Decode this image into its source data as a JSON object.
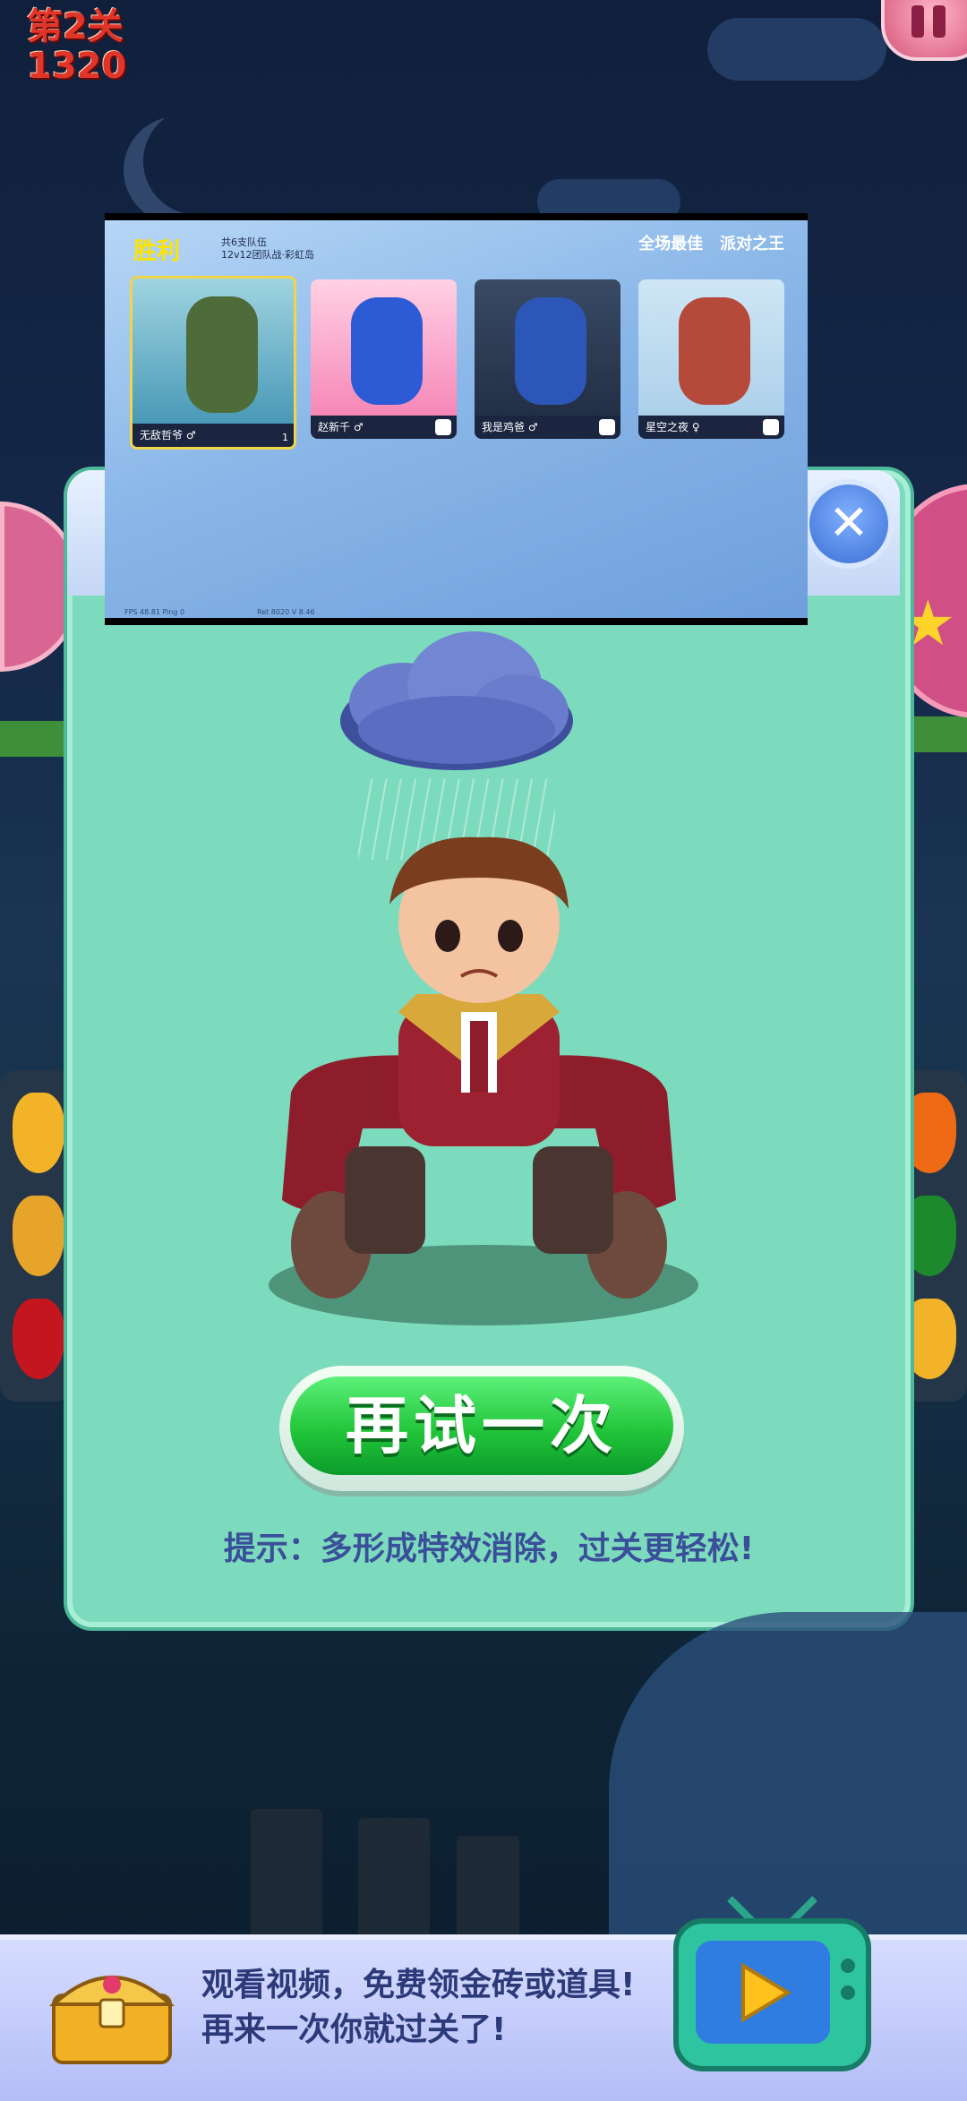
{
  "hud": {
    "level": "第2关",
    "score": "1320"
  },
  "embed": {
    "victory": "胜利",
    "teams_line1": "共6支队伍",
    "teams_line2": "12v12团队战·彩虹岛",
    "award1": "全场最佳",
    "award2": "派对之王",
    "players": [
      {
        "name": "无敌哲爷 ♂",
        "likes": "1"
      },
      {
        "name": "赵新千 ♂",
        "likes": ""
      },
      {
        "name": "我是鸡爸 ♂",
        "likes": ""
      },
      {
        "name": "星空之夜 ♀",
        "likes": ""
      }
    ],
    "footer1": "FPS 48.81  Ping 0",
    "footer2": "Ret 8020  V 8.46"
  },
  "dialog": {
    "retry_label": "再试一次",
    "hint": "提示：多形成特效消除，过关更轻松!",
    "close_icon": "close-icon"
  },
  "banner": {
    "line1": "观看视频，免费领金砖或道具!",
    "line2": "再来一次你就过关了!"
  },
  "colors": {
    "dialog_bg": "#7ddbbd",
    "retry_green": "#22c63a",
    "hint_text": "#3a4f9a",
    "level_red": "#e2352a"
  }
}
